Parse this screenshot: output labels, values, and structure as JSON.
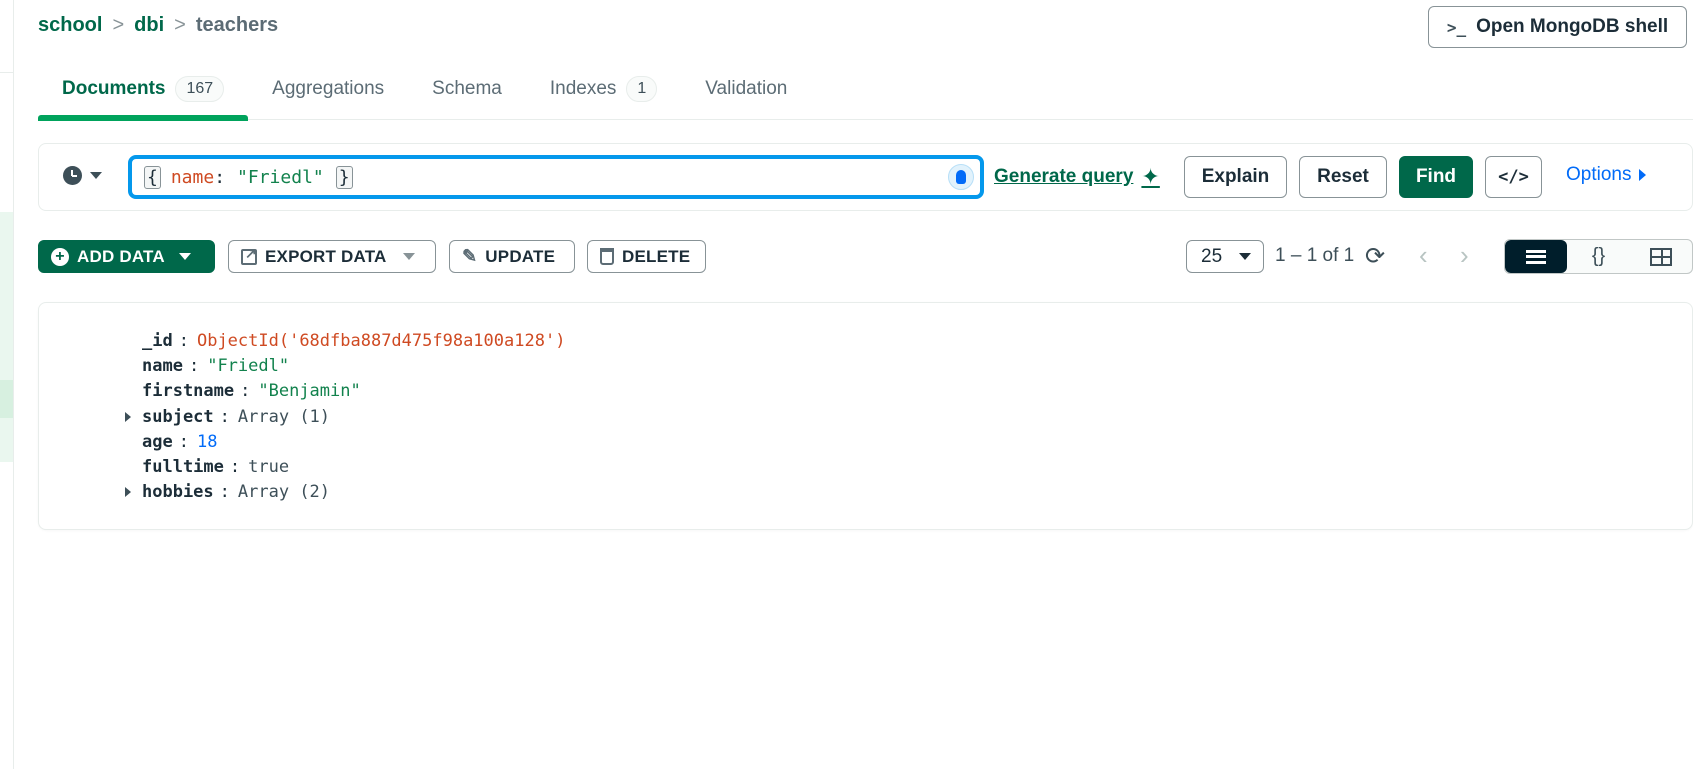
{
  "breadcrumb": {
    "items": [
      "school",
      "dbi",
      "teachers"
    ],
    "separator": ">"
  },
  "shell_button": {
    "prompt": ">_",
    "label": "Open MongoDB shell"
  },
  "tabs": [
    {
      "label": "Documents",
      "count": "167"
    },
    {
      "label": "Aggregations"
    },
    {
      "label": "Schema"
    },
    {
      "label": "Indexes",
      "count": "1"
    },
    {
      "label": "Validation"
    }
  ],
  "query": {
    "open_brace": "{",
    "key": "name",
    "colon": ":",
    "value": "\"Friedl\"",
    "close_brace": "}",
    "generate_label": "Generate query",
    "sparkle": "✦",
    "explain": "Explain",
    "reset": "Reset",
    "find": "Find",
    "code": "</>",
    "options": "Options"
  },
  "toolbar": {
    "add_data": "ADD DATA",
    "add_icon": "+",
    "export_data": "EXPORT DATA",
    "update": "UPDATE",
    "delete": "DELETE",
    "page_size": "25",
    "range": "1 – 1 of 1",
    "refresh": "⟳",
    "prev": "‹",
    "next": "›",
    "json_view": "{}"
  },
  "document": {
    "fields": [
      {
        "key": "_id",
        "value": "ObjectId('68dfba887d475f98a100a128')",
        "type": "oid"
      },
      {
        "key": "name",
        "value": "\"Friedl\"",
        "type": "str"
      },
      {
        "key": "firstname",
        "value": "\"Benjamin\"",
        "type": "str"
      },
      {
        "key": "subject",
        "value": "Array (1)",
        "type": "array"
      },
      {
        "key": "age",
        "value": "18",
        "type": "num"
      },
      {
        "key": "fulltime",
        "value": "true",
        "type": "plain"
      },
      {
        "key": "hobbies",
        "value": "Array (2)",
        "type": "array"
      }
    ]
  },
  "colors": {
    "brand_green": "#00684a",
    "accent_blue": "#0498ec",
    "link_blue": "#016bf8",
    "oid_red": "#cf4a22",
    "string_green": "#12824d"
  }
}
